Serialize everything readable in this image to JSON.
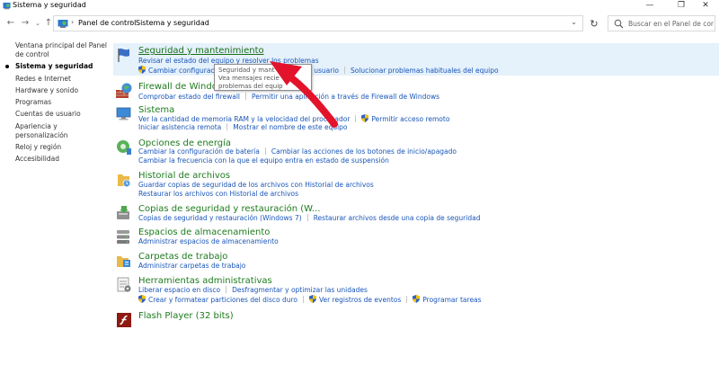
{
  "window": {
    "title": "Sistema y seguridad",
    "minimize": "—",
    "maximize": "❐",
    "close": "✕"
  },
  "address": {
    "segments": [
      "Panel de control",
      "Sistema y seguridad"
    ],
    "search_placeholder": "Buscar en el Panel de control"
  },
  "sidebar": {
    "items": [
      {
        "label": "Ventana principal del Panel de control"
      },
      {
        "label": "Sistema y seguridad"
      },
      {
        "label": "Redes e Internet"
      },
      {
        "label": "Hardware y sonido"
      },
      {
        "label": "Programas"
      },
      {
        "label": "Cuentas de usuario"
      },
      {
        "label": "Apariencia y personalización"
      },
      {
        "label": "Reloj y región"
      },
      {
        "label": "Accesibilidad"
      }
    ]
  },
  "categories": [
    {
      "title": "Seguridad y mantenimiento",
      "icon": "flag-icon",
      "rows": [
        [
          "Revisar el estado del equipo y resolver los problemas"
        ],
        [
          "Cambiar configuración de Control de cuentas de usuario",
          "Solucionar problemas habituales del equipo"
        ]
      ]
    },
    {
      "title": "Firewall de Windows",
      "icon": "firewall-icon",
      "rows": [
        [
          "Comprobar estado del firewall",
          "Permitir una aplicación a través de Firewall de Windows"
        ]
      ]
    },
    {
      "title": "Sistema",
      "icon": "computer-icon",
      "rows": [
        [
          "Ver la cantidad de memoria RAM y la velocidad del procesador",
          "Permitir acceso remoto"
        ],
        [
          "Iniciar asistencia remota",
          "Mostrar el nombre de este equipo"
        ]
      ]
    },
    {
      "title": "Opciones de energía",
      "icon": "power-icon",
      "rows": [
        [
          "Cambiar la configuración de batería",
          "Cambiar las acciones de los botones de inicio/apagado"
        ],
        [
          "Cambiar la frecuencia con la que el equipo entra en estado de suspensión"
        ]
      ]
    },
    {
      "title": "Historial de archivos",
      "icon": "file-history-icon",
      "rows": [
        [
          "Guardar copias de seguridad de los archivos con Historial de archivos"
        ],
        [
          "Restaurar los archivos con Historial de archivos"
        ]
      ]
    },
    {
      "title": "Copias de seguridad y restauración (W...",
      "icon": "backup-icon",
      "rows": [
        [
          "Copias de seguridad y restauración (Windows 7)",
          "Restaurar archivos desde una copia de seguridad"
        ]
      ]
    },
    {
      "title": "Espacios de almacenamiento",
      "icon": "storage-icon",
      "rows": [
        [
          "Administrar espacios de almacenamiento"
        ]
      ]
    },
    {
      "title": "Carpetas de trabajo",
      "icon": "work-folders-icon",
      "rows": [
        [
          "Administrar carpetas de trabajo"
        ]
      ]
    },
    {
      "title": "Herramientas administrativas",
      "icon": "admin-tools-icon",
      "rows": [
        [
          "Liberar espacio en disco",
          "Desfragmentar y optimizar las unidades"
        ],
        [
          "Crear y formatear particiones del disco duro",
          "Ver registros de eventos",
          "Programar tareas"
        ]
      ]
    },
    {
      "title": "Flash Player (32 bits)",
      "icon": "flash-icon",
      "rows": []
    }
  ],
  "tooltip": {
    "lines": [
      "Seguridad y mant",
      "Vea mensajes recie",
      "problemas del equip"
    ]
  },
  "colors": {
    "title_green": "#1e7b1e",
    "link_blue": "#1a56b8",
    "highlight": "#e5f1fb",
    "arrow_red": "#e3132b"
  }
}
